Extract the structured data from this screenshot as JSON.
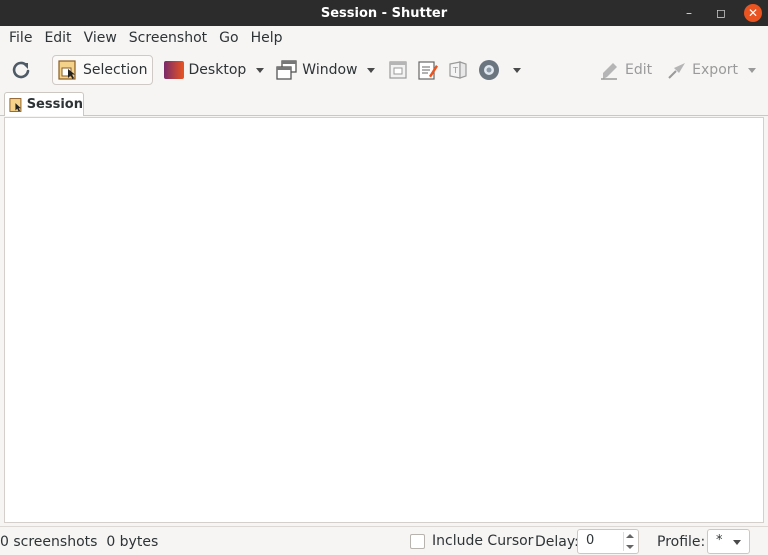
{
  "window": {
    "title": "Session - Shutter"
  },
  "menubar": {
    "items": [
      "File",
      "Edit",
      "View",
      "Screenshot",
      "Go",
      "Help"
    ]
  },
  "toolbar": {
    "refresh_icon": "refresh-icon",
    "selection_label": "Selection",
    "desktop_label": "Desktop",
    "window_label": "Window",
    "edit_label": "Edit",
    "export_label": "Export"
  },
  "tabs": [
    {
      "label": "Session"
    }
  ],
  "status": {
    "summary": "0 screenshots  0 bytes",
    "include_cursor_label": "Include Cursor",
    "include_cursor_checked": false,
    "delay_label": "Delay:",
    "delay_value": "0",
    "profile_label": "Profile:",
    "profile_value": "*"
  },
  "colors": {
    "titlebar": "#2c2c2c",
    "close_button": "#e95420",
    "content_bg": "#ffffff"
  }
}
